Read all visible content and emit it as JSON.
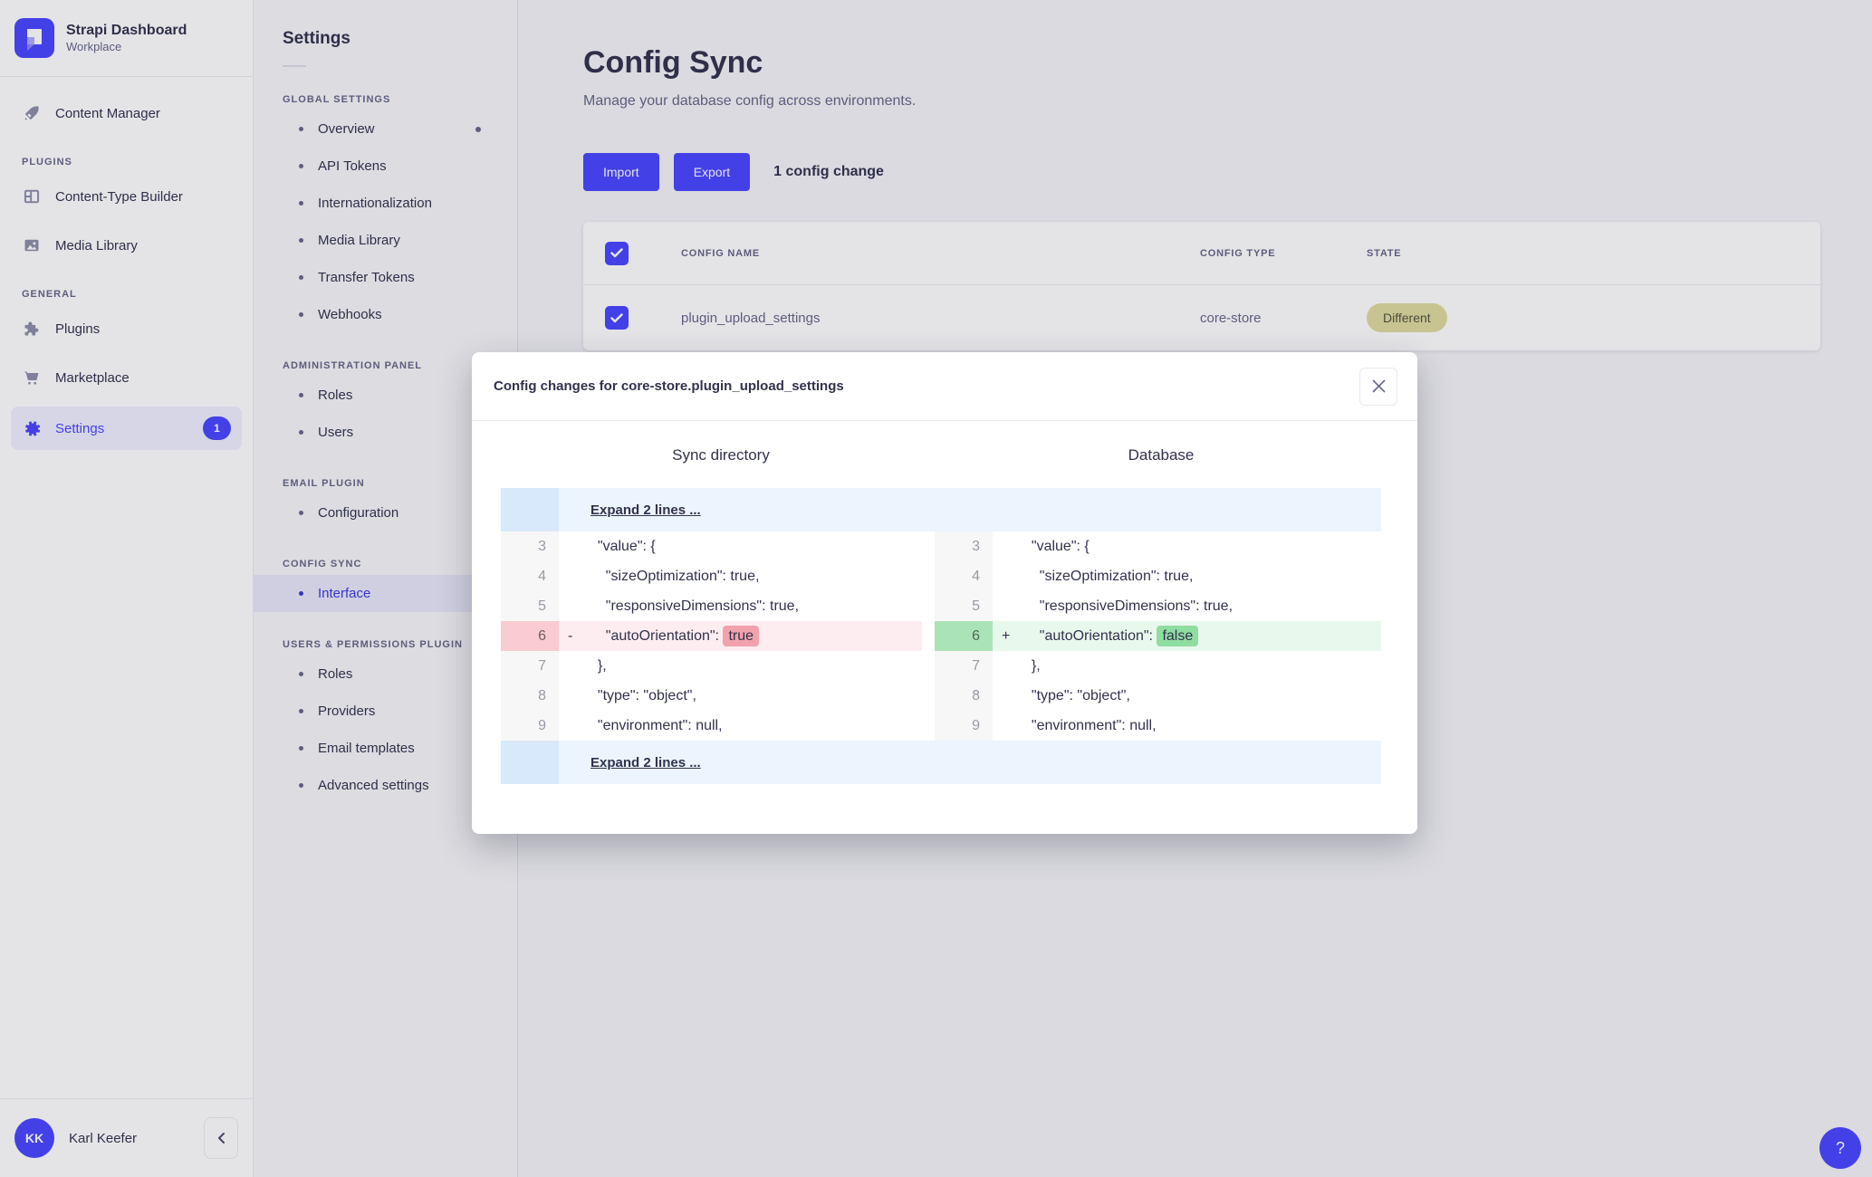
{
  "brand": {
    "title": "Strapi Dashboard",
    "subtitle": "Workplace"
  },
  "nav": {
    "items": [
      {
        "label": "Content Manager",
        "icon": "pen-icon"
      }
    ],
    "sections": [
      {
        "label": "PLUGINS",
        "items": [
          {
            "label": "Content-Type Builder",
            "icon": "layout-icon"
          },
          {
            "label": "Media Library",
            "icon": "image-icon"
          }
        ]
      },
      {
        "label": "GENERAL",
        "items": [
          {
            "label": "Plugins",
            "icon": "puzzle-icon"
          },
          {
            "label": "Marketplace",
            "icon": "cart-icon"
          },
          {
            "label": "Settings",
            "icon": "gear-icon",
            "active": true,
            "badge": "1"
          }
        ]
      }
    ],
    "user": {
      "initials": "KK",
      "name": "Karl Keefer"
    }
  },
  "settings_panel": {
    "title": "Settings",
    "sections": [
      {
        "label": "GLOBAL SETTINGS",
        "items": [
          {
            "label": "Overview",
            "has_notification_dot": true
          },
          {
            "label": "API Tokens"
          },
          {
            "label": "Internationalization"
          },
          {
            "label": "Media Library"
          },
          {
            "label": "Transfer Tokens"
          },
          {
            "label": "Webhooks"
          }
        ]
      },
      {
        "label": "ADMINISTRATION PANEL",
        "items": [
          {
            "label": "Roles"
          },
          {
            "label": "Users"
          }
        ]
      },
      {
        "label": "EMAIL PLUGIN",
        "items": [
          {
            "label": "Configuration"
          }
        ]
      },
      {
        "label": "CONFIG SYNC",
        "items": [
          {
            "label": "Interface",
            "active": true
          }
        ]
      },
      {
        "label": "USERS & PERMISSIONS PLUGIN",
        "items": [
          {
            "label": "Roles"
          },
          {
            "label": "Providers"
          },
          {
            "label": "Email templates"
          },
          {
            "label": "Advanced settings"
          }
        ]
      }
    ]
  },
  "main": {
    "title": "Config Sync",
    "subtitle": "Manage your database config across environments.",
    "import_label": "Import",
    "export_label": "Export",
    "change_count_label": "1 config change",
    "table": {
      "headers": [
        "CONFIG NAME",
        "CONFIG TYPE",
        "STATE"
      ],
      "rows": [
        {
          "checked": true,
          "config_name": "plugin_upload_settings",
          "config_type": "core-store",
          "state": "Different"
        }
      ],
      "header_checkbox_checked": true
    }
  },
  "modal": {
    "title": "Config changes for core-store.plugin_upload_settings",
    "diff": {
      "left_title": "Sync directory",
      "right_title": "Database",
      "expand_top": "Expand 2 lines ...",
      "expand_bottom": "Expand 2 lines ...",
      "rows": [
        {
          "num": "3",
          "left": {
            "text": "  \"value\": {"
          },
          "right": {
            "text": "  \"value\": {"
          }
        },
        {
          "num": "4",
          "left": {
            "text": "    \"sizeOptimization\": true,"
          },
          "right": {
            "text": "    \"sizeOptimization\": true,"
          }
        },
        {
          "num": "5",
          "left": {
            "text": "    \"responsiveDimensions\": true,"
          },
          "right": {
            "text": "    \"responsiveDimensions\": true,"
          }
        },
        {
          "num": "6",
          "changed": true,
          "left": {
            "marker": "-",
            "prefix": "    \"autoOrientation\": ",
            "token": "true"
          },
          "right": {
            "marker": "+",
            "prefix": "    \"autoOrientation\": ",
            "token": "false"
          }
        },
        {
          "num": "7",
          "left": {
            "text": "  },"
          },
          "right": {
            "text": "  },"
          }
        },
        {
          "num": "8",
          "left": {
            "text": "  \"type\": \"object\","
          },
          "right": {
            "text": "  \"type\": \"object\","
          }
        },
        {
          "num": "9",
          "left": {
            "text": "  \"environment\": null,"
          },
          "right": {
            "text": "  \"environment\": null,"
          }
        }
      ]
    }
  },
  "help": {
    "label": "?"
  },
  "colors": {
    "accent": "#4945ff",
    "diff_removed_row": "#fdedf0",
    "diff_removed_token": "#f1a2ad",
    "diff_added_row": "#e9f8ec",
    "diff_added_token": "#8edda1",
    "expand_row": "#ecf5fd",
    "state_badge": "#dedb9e"
  }
}
